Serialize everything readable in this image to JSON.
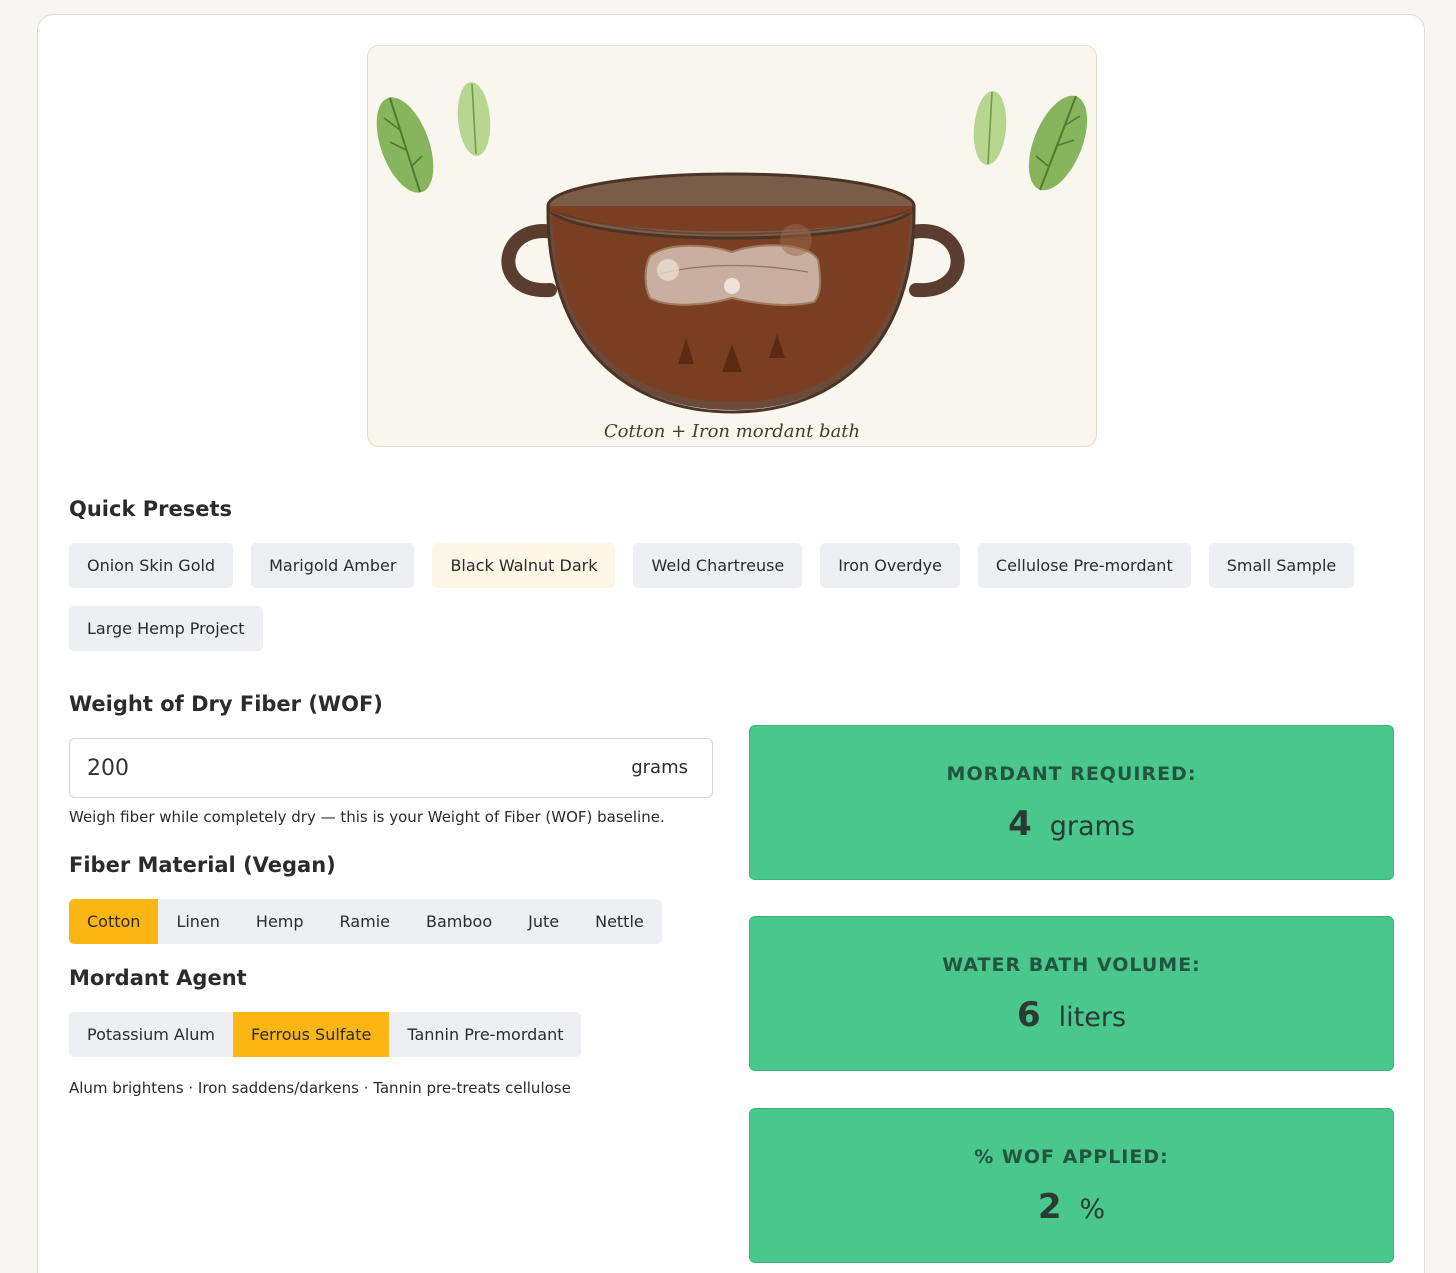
{
  "illustration": {
    "caption": "Cotton + Iron mordant bath"
  },
  "presets": {
    "title": "Quick Presets",
    "items": [
      "Onion Skin Gold",
      "Marigold Amber",
      "Black Walnut Dark",
      "Weld Chartreuse",
      "Iron Overdye",
      "Cellulose Pre-mordant",
      "Small Sample",
      "Large Hemp Project"
    ],
    "active": "Black Walnut Dark"
  },
  "weight": {
    "title": "Weight of Dry Fiber (WOF)",
    "value": "200",
    "unit": "grams",
    "hint": "Weigh fiber while completely dry — this is your Weight of Fiber (WOF) baseline."
  },
  "fiber": {
    "title": "Fiber Material (Vegan)",
    "options": [
      "Cotton",
      "Linen",
      "Hemp",
      "Ramie",
      "Bamboo",
      "Jute",
      "Nettle"
    ],
    "selected": "Cotton"
  },
  "mordant": {
    "title": "Mordant Agent",
    "options": [
      "Potassium Alum",
      "Ferrous Sulfate",
      "Tannin Pre-mordant"
    ],
    "selected": "Ferrous Sulfate",
    "hint": "Alum brightens · Iron saddens/darkens · Tannin pre-treats cellulose"
  },
  "results": {
    "mordant": {
      "label": "MORDANT REQUIRED:",
      "value": "4",
      "unit": "grams"
    },
    "water": {
      "label": "WATER BATH VOLUME:",
      "value": "6",
      "unit": "liters"
    },
    "wof": {
      "label": "% WOF APPLIED:",
      "value": "2",
      "unit": "%"
    }
  },
  "colors": {
    "accent": "#fbb614",
    "result_bg": "#49c78c",
    "dye_bath": "#7a3f22",
    "pot": "#5c4033"
  }
}
